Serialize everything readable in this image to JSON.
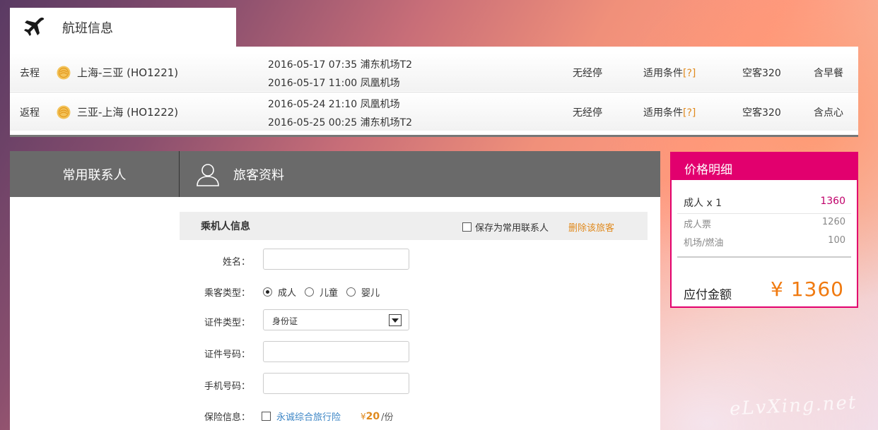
{
  "flight_section": {
    "title": "航班信息",
    "rows": [
      {
        "direction": "去程",
        "route": "上海-三亚 (HO1221)",
        "depart": "2016-05-17 07:35 浦东机场T2",
        "arrive": "2016-05-17 11:00 凤凰机场",
        "stops": "无经停",
        "conditions_label": "适用条件",
        "conditions_link": "[?]",
        "aircraft": "空客320",
        "meal": "含早餐"
      },
      {
        "direction": "返程",
        "route": "三亚-上海 (HO1222)",
        "depart": "2016-05-24 21:10 凤凰机场",
        "arrive": "2016-05-25 00:25 浦东机场T2",
        "stops": "无经停",
        "conditions_label": "适用条件",
        "conditions_link": "[?]",
        "aircraft": "空客320",
        "meal": "含点心"
      }
    ]
  },
  "form_tabs": {
    "contacts": "常用联系人",
    "traveler_info": "旅客资料"
  },
  "passenger": {
    "header_title": "乘机人信息",
    "save_contact_label": "保存为常用联系人",
    "delete_label": "删除该旅客",
    "name_label": "姓名：",
    "name_value": "",
    "type_label": "乘客类型：",
    "type_options": [
      "成人",
      "儿童",
      "婴儿"
    ],
    "type_selected": "成人",
    "id_type_label": "证件类型：",
    "id_type_value": "身份证",
    "id_number_label": "证件号码：",
    "id_number_value": "",
    "phone_label": "手机号码：",
    "phone_value": "",
    "insurance_label": "保险信息：",
    "insurance_name": "永诚综合旅行险",
    "insurance_currency": "¥",
    "insurance_amount": "20",
    "insurance_unit": "/份"
  },
  "price": {
    "title": "价格明细",
    "adult_label": "成人 x 1",
    "adult_value": "1360",
    "ticket_label": "成人票",
    "ticket_value": "1260",
    "fuel_label": "机场/燃油",
    "fuel_value": "100",
    "total_label": "应付金额",
    "total_value": "¥ 1360"
  },
  "watermark": "eLvXing.net",
  "colors": {
    "accent": "#e2006e",
    "orange": "#f07a10",
    "link": "#3d86c6",
    "tabs_bg": "#6a6a6a"
  }
}
